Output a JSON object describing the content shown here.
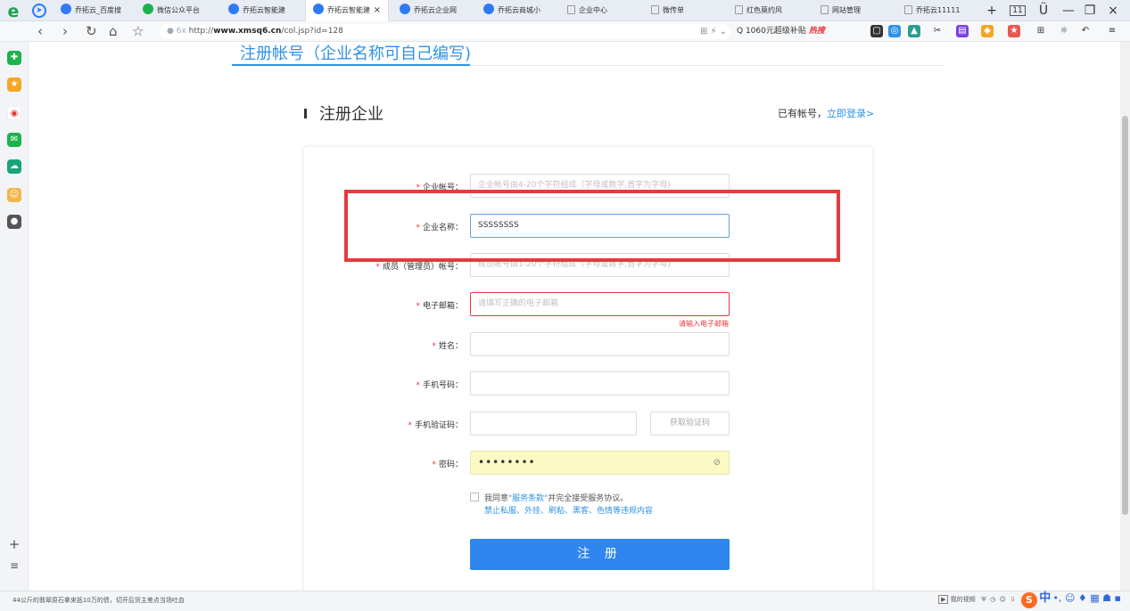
{
  "browser": {
    "tabs": [
      {
        "label": "乔拓云_百度搜",
        "icon": "search-icon"
      },
      {
        "label": "微信公众平台",
        "icon": "wechat-icon"
      },
      {
        "label": "乔拓云智能建",
        "icon": "qiaotuoyun-icon"
      },
      {
        "label": "乔拓云智能建",
        "icon": "qiaotuoyun-icon"
      },
      {
        "label": "乔拓云企业网",
        "icon": "qiaotuoyun-icon"
      },
      {
        "label": "乔拓云商城小",
        "icon": "qiaotuoyun-icon"
      },
      {
        "label": "企业中心",
        "icon": "page-icon"
      },
      {
        "label": "微传单",
        "icon": "page-icon"
      },
      {
        "label": "红色莫约风",
        "icon": "page-icon"
      },
      {
        "label": "网站管理",
        "icon": "page-icon"
      },
      {
        "label": "乔拓云11111",
        "icon": "page-icon"
      }
    ],
    "active_tab_index": 3,
    "tab_count": "11",
    "url_prefix": "http://",
    "url_domain": "www.xmsq6.cn",
    "url_path": "/col.jsp?id=128",
    "search_text": "Q 1060元超级补贴",
    "hot_label": "热搜"
  },
  "page": {
    "header_title": "注册帐号（企业名称可自己编写)",
    "section_title": "注册企业",
    "have_account": "已有帐号，",
    "login_link": "立即登录>",
    "fields": {
      "enterprise_account": {
        "label": "企业帐号：",
        "placeholder": "企业帐号由4-20个字符组成（字母或数字,首字为字母)"
      },
      "enterprise_name": {
        "label": "企业名称：",
        "value": "SSSSSSSS"
      },
      "member_account": {
        "label": "成员（管理员）帐号：",
        "placeholder": "成员帐号由1-20个字符组成（字母或数字,首字为字母)"
      },
      "email": {
        "label": "电子邮箱：",
        "placeholder": "请填写正确的电子邮箱",
        "error": "请输入电子邮箱"
      },
      "name": {
        "label": "姓名："
      },
      "phone": {
        "label": "手机号码："
      },
      "sms_code": {
        "label": "手机验证码：",
        "button": "获取验证码"
      },
      "password": {
        "label": "密码：",
        "value": "••••••••"
      }
    },
    "agree_prefix": "我同意",
    "agree_link": "\"服务条款\"",
    "agree_suffix": "并完全接受服务协议。",
    "agree_note": "禁止私服、外挂、刷粘、黑客、色情等违规内容",
    "submit": "注 册"
  },
  "status_bar": {
    "news": "44公斤的翡翠原石拿来抵10万的债，切开后货主差点当场吐血",
    "video": "我的视频"
  },
  "colors": {
    "accent": "#2e86ee",
    "error": "#e4393c",
    "highlight_box": "#e43b3b",
    "autofill": "#fbf9c4"
  }
}
